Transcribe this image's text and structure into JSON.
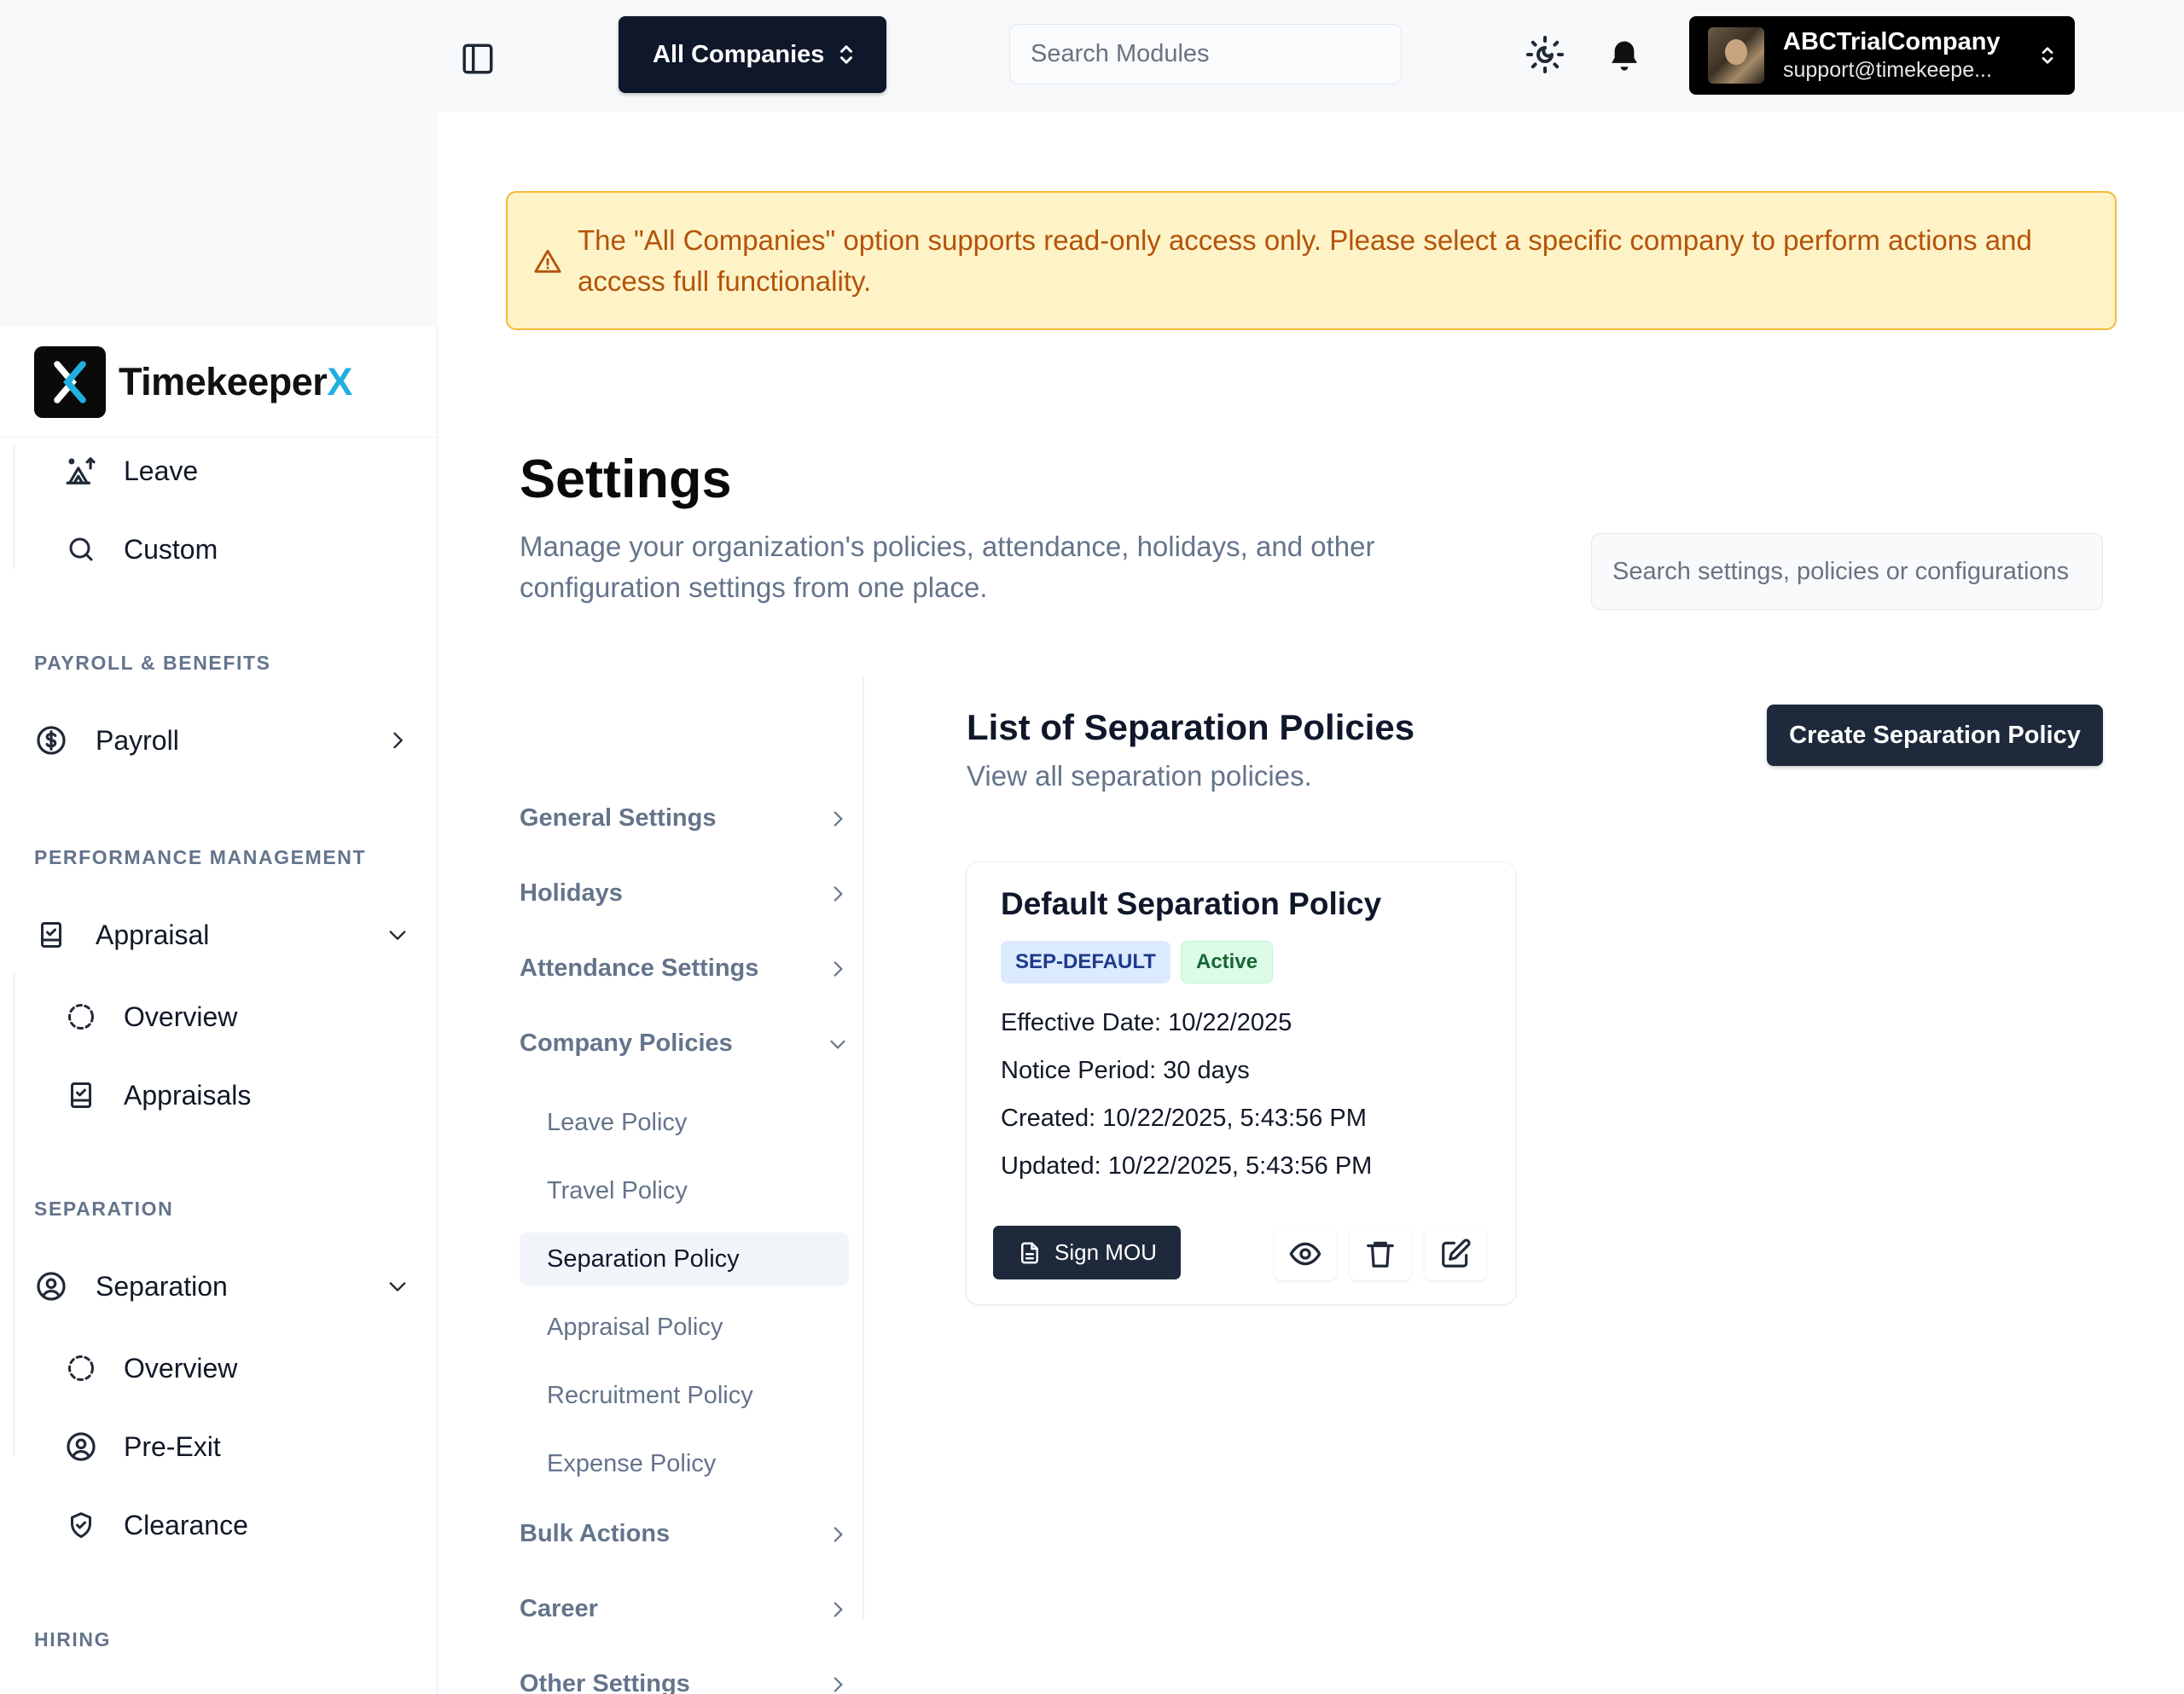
{
  "topbar": {
    "company_select": "All Companies",
    "search_placeholder": "Search Modules",
    "account_name": "ABCTrialCompany",
    "account_email": "support@timekeepe..."
  },
  "brand": {
    "name": "Timekeeper",
    "suffix": "X",
    "accent": "#1fb0e0"
  },
  "sidebar": {
    "items_top": [
      {
        "label": "Leave",
        "icon": "tent-icon"
      },
      {
        "label": "Custom",
        "icon": "search-icon"
      }
    ],
    "sections": [
      {
        "heading": "PAYROLL & BENEFITS",
        "main": {
          "label": "Payroll",
          "icon": "dollar-circle-icon"
        }
      },
      {
        "heading": "PERFORMANCE MANAGEMENT",
        "main": {
          "label": "Appraisal",
          "icon": "clipboard-icon"
        },
        "subs": [
          {
            "label": "Overview",
            "icon": "dashed-circle-icon"
          },
          {
            "label": "Appraisals",
            "icon": "clipboard-check-icon"
          }
        ]
      },
      {
        "heading": "SEPARATION",
        "main": {
          "label": "Separation",
          "icon": "user-circle-icon"
        },
        "subs": [
          {
            "label": "Overview",
            "icon": "dashed-circle-icon"
          },
          {
            "label": "Pre-Exit",
            "icon": "user-circle-icon"
          },
          {
            "label": "Clearance",
            "icon": "shield-check-icon"
          }
        ]
      },
      {
        "heading": "HIRING"
      }
    ]
  },
  "alert": {
    "text": "The \"All Companies\" option supports read-only access only. Please select a specific company to perform actions and access full functionality."
  },
  "page": {
    "title": "Settings",
    "subtitle": "Manage your organization's policies, attendance, holidays, and other configuration settings from one place.",
    "search_placeholder": "Search settings, policies or configurations"
  },
  "settings_nav": {
    "groups": [
      "General Settings",
      "Holidays",
      "Attendance Settings",
      "Company Policies",
      "Bulk Actions",
      "Career",
      "Other Settings"
    ],
    "company_policies": [
      "Leave Policy",
      "Travel Policy",
      "Separation Policy",
      "Appraisal Policy",
      "Recruitment Policy",
      "Expense Policy"
    ],
    "active": "Separation Policy"
  },
  "content": {
    "title": "List of Separation Policies",
    "subtitle": "View all separation policies.",
    "create_button": "Create Separation Policy",
    "policy": {
      "name": "Default Separation Policy",
      "code": "SEP-DEFAULT",
      "status": "Active",
      "effective_date": "Effective Date: 10/22/2025",
      "notice_period": "Notice Period: 30 days",
      "created": "Created: 10/22/2025, 5:43:56 PM",
      "updated": "Updated: 10/22/2025, 5:43:56 PM",
      "sign_button": "Sign MOU"
    }
  }
}
